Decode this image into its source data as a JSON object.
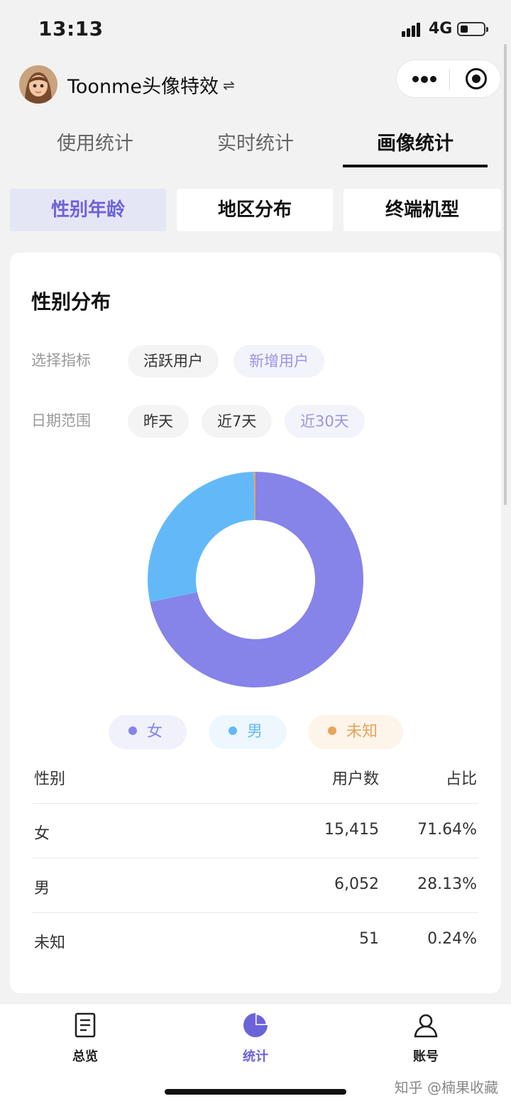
{
  "status": {
    "time": "13:13",
    "network": "4G"
  },
  "header": {
    "app_title": "Toonme头像特效",
    "swap_symbol": "⇌"
  },
  "tabs": [
    {
      "label": "使用统计"
    },
    {
      "label": "实时统计"
    },
    {
      "label": "画像统计",
      "active": true
    }
  ],
  "segments": [
    {
      "label": "性别年龄",
      "active": true
    },
    {
      "label": "地区分布"
    },
    {
      "label": "终端机型"
    }
  ],
  "card": {
    "title": "性别分布",
    "metric_label": "选择指标",
    "metric_options": [
      {
        "label": "活跃用户"
      },
      {
        "label": "新增用户",
        "active": true
      }
    ],
    "date_label": "日期范围",
    "date_options": [
      {
        "label": "昨天"
      },
      {
        "label": "近7天"
      },
      {
        "label": "近30天",
        "active": true
      }
    ]
  },
  "colors": {
    "female": "#8683e9",
    "male": "#63b9f8",
    "unknown": "#e5a45a",
    "accent": "#6c63d9"
  },
  "chart_data": {
    "type": "pie",
    "categories": [
      "女",
      "男",
      "未知"
    ],
    "values": [
      15415,
      6052,
      51
    ],
    "percentages": [
      71.64,
      28.13,
      0.24
    ],
    "legend": [
      "女",
      "男",
      "未知"
    ]
  },
  "table": {
    "headers": [
      "性别",
      "用户数",
      "占比"
    ],
    "rows": [
      [
        "女",
        "15,415",
        "71.64%"
      ],
      [
        "男",
        "6,052",
        "28.13%"
      ],
      [
        "未知",
        "51",
        "0.24%"
      ]
    ]
  },
  "bottom_nav": [
    {
      "label": "总览",
      "icon": "document-icon"
    },
    {
      "label": "统计",
      "icon": "pie-chart-icon",
      "active": true
    },
    {
      "label": "账号",
      "icon": "user-icon"
    }
  ],
  "watermark": "知乎 @楠果收藏"
}
